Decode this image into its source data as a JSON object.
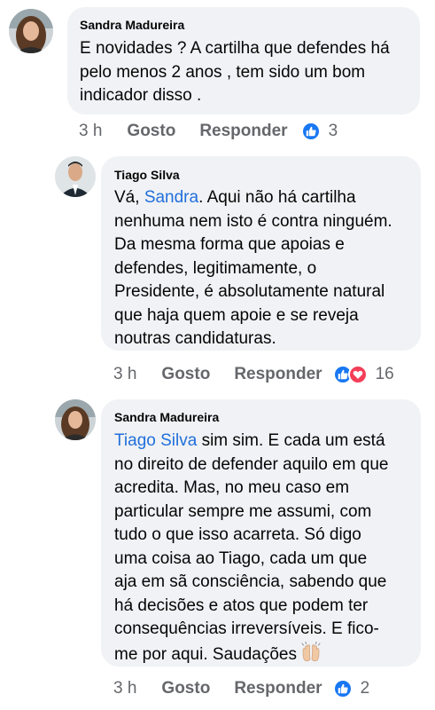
{
  "comments": [
    {
      "author": "Sandra Madureira",
      "text_lines": [
        "E novidades ? A cartilha que defendes há",
        "pelo menos 2 anos , tem sido um bom",
        "indicador disso ."
      ],
      "time": "3 h",
      "like_label": "Gosto",
      "reply_label": "Responder",
      "reactions": [
        "like-icon"
      ],
      "reaction_count": "3"
    },
    {
      "author": "Tiago Silva",
      "mention": "Sandra",
      "first_line_prefix": "Vá, ",
      "first_line_suffix": ". Aqui não há cartilha",
      "text_lines": [
        "nenhuma nem isto é contra ninguém.",
        "Da mesma forma que apoias e",
        "defendes, legitimamente, o",
        "Presidente, é absolutamente natural",
        "que haja quem apoie e se reveja",
        "noutras candidaturas."
      ],
      "time": "3 h",
      "like_label": "Gosto",
      "reply_label": "Responder",
      "reactions": [
        "like-icon",
        "love-icon"
      ],
      "reaction_count": "16"
    },
    {
      "author": "Sandra Madureira",
      "mention": "Tiago Silva",
      "first_line_suffix": " sim sim. E cada um está",
      "text_lines": [
        "no direito de defender aquilo em que",
        "acredita. Mas, no meu caso em",
        "particular sempre me assumi, com",
        "tudo o que isso acarreta. Só digo",
        "uma coisa ao Tiago, cada um que",
        "aja em sã consciência, sabendo que",
        "há decisões e atos que podem ter",
        "consequências irreversíveis. E fico-"
      ],
      "last_line": "me por aqui. Saudações",
      "emoji": "raising-hands-emoji",
      "time": "3 h",
      "like_label": "Gosto",
      "reply_label": "Responder",
      "reactions": [
        "like-icon"
      ],
      "reaction_count": "2"
    }
  ],
  "colors": {
    "bubble": "#f0f2f5",
    "mention": "#216fdb",
    "meta": "#65676b",
    "like": "#1877f2",
    "love": "#f33e58"
  }
}
